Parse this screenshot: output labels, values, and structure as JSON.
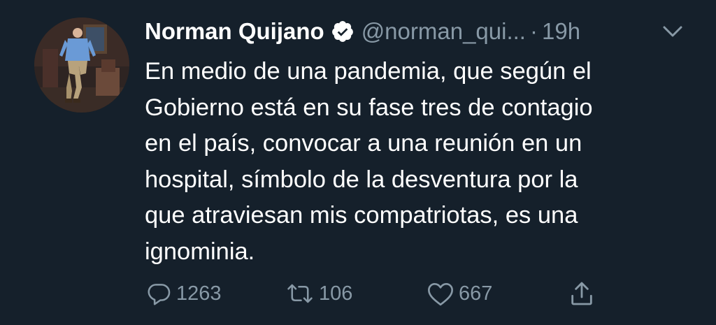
{
  "tweet": {
    "author": {
      "name": "Norman Quijano",
      "handle": "@norman_qui...",
      "verified": true
    },
    "separator": "·",
    "time": "19h",
    "text_lines": [
      "En medio de una pandemia, que según el",
      "Gobierno está en su fase tres de contagio",
      "en el país, convocar a una reunión en un",
      "hospital, símbolo de la desventura por la",
      "que atraviesan mis compatriotas, es una",
      "ignominia."
    ],
    "actions": {
      "reply": {
        "icon": "reply-icon",
        "count": "1263"
      },
      "retweet": {
        "icon": "retweet-icon",
        "count": "106"
      },
      "like": {
        "icon": "heart-icon",
        "count": "667"
      },
      "share": {
        "icon": "share-icon"
      }
    }
  },
  "colors": {
    "background": "#15202b",
    "primary_text": "#ffffff",
    "secondary_text": "#8899a6"
  }
}
